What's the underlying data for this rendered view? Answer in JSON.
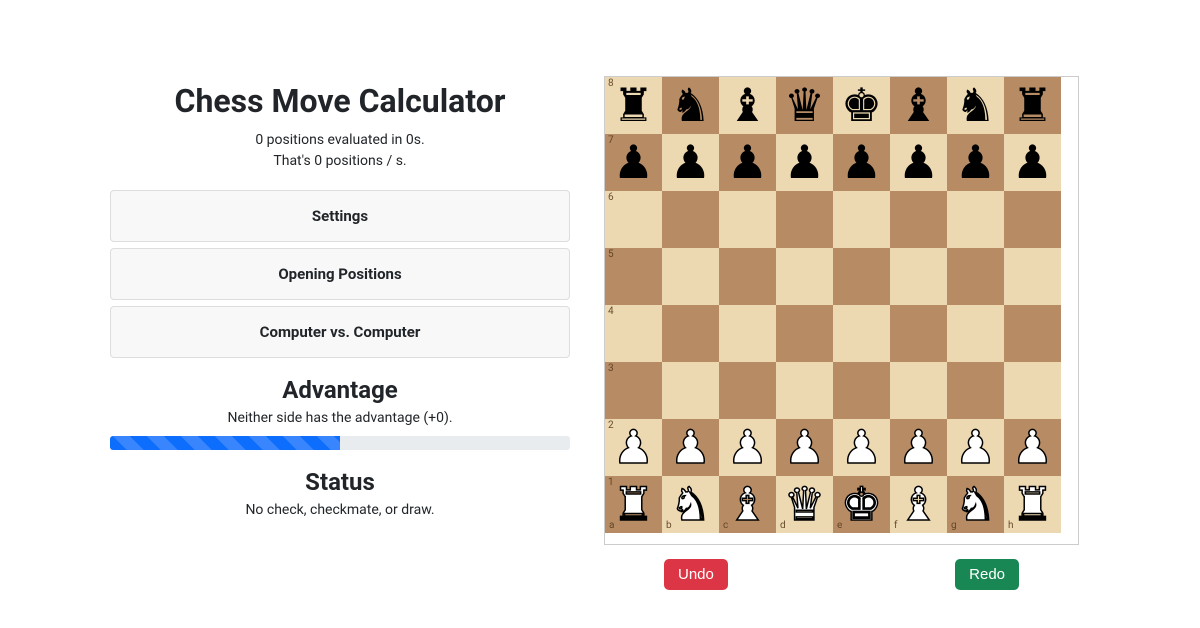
{
  "title": "Chess Move Calculator",
  "stats": {
    "line1": "0  positions evaluated in  0s.",
    "line2": "That's  0  positions / s."
  },
  "accordion": {
    "settings": "Settings",
    "openings": "Opening Positions",
    "cvc": "Computer vs. Computer"
  },
  "advantage": {
    "heading": "Advantage",
    "text": "Neither side has the advantage (+0).",
    "percent": 50
  },
  "status": {
    "heading": "Status",
    "text": "No check, checkmate, or draw."
  },
  "buttons": {
    "undo": "Undo",
    "redo": "Redo"
  },
  "board": {
    "ranks": [
      "8",
      "7",
      "6",
      "5",
      "4",
      "3",
      "2",
      "1"
    ],
    "files": [
      "a",
      "b",
      "c",
      "d",
      "e",
      "f",
      "g",
      "h"
    ],
    "position": [
      [
        "br",
        "bn",
        "bb",
        "bq",
        "bk",
        "bb",
        "bn",
        "br"
      ],
      [
        "bp",
        "bp",
        "bp",
        "bp",
        "bp",
        "bp",
        "bp",
        "bp"
      ],
      [
        "",
        "",
        "",
        "",
        "",
        "",
        "",
        ""
      ],
      [
        "",
        "",
        "",
        "",
        "",
        "",
        "",
        ""
      ],
      [
        "",
        "",
        "",
        "",
        "",
        "",
        "",
        ""
      ],
      [
        "",
        "",
        "",
        "",
        "",
        "",
        "",
        ""
      ],
      [
        "wp",
        "wp",
        "wp",
        "wp",
        "wp",
        "wp",
        "wp",
        "wp"
      ],
      [
        "wr",
        "wn",
        "wb",
        "wq",
        "wk",
        "wb",
        "wn",
        "wr"
      ]
    ]
  },
  "glyphs": {
    "k": "♚",
    "q": "♛",
    "r": "♜",
    "b": "♝",
    "n": "♞",
    "p": "♟"
  }
}
